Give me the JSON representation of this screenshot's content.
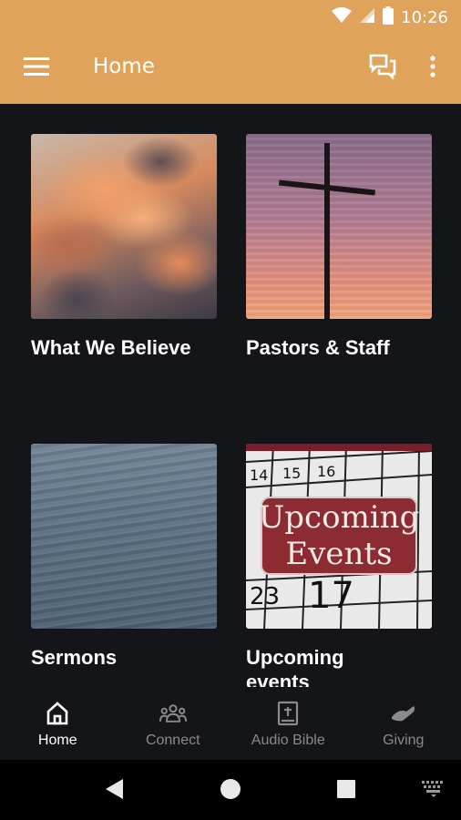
{
  "status_bar": {
    "time": "10:26",
    "icons": [
      "wifi-icon",
      "signal-icon",
      "battery-icon"
    ]
  },
  "app_bar": {
    "title": "Home",
    "icons": [
      "menu-icon",
      "chat-icon",
      "overflow-menu-icon"
    ],
    "background_color": "#E0A35C"
  },
  "tiles": [
    {
      "label": "What We Believe",
      "image": "clouds-photo"
    },
    {
      "label": "Pastors & Staff",
      "image": "cross-sky-photo"
    },
    {
      "label": "Sermons",
      "image": "sea-photo"
    },
    {
      "label": "Upcoming events",
      "image": "calendar-photo",
      "image_text_line1": "Upcoming",
      "image_text_line2": "Events"
    }
  ],
  "bottom_nav": {
    "items": [
      {
        "label": "Home",
        "icon": "home-icon",
        "active": true
      },
      {
        "label": "Connect",
        "icon": "group-icon",
        "active": false
      },
      {
        "label": "Audio Bible",
        "icon": "bible-icon",
        "active": false
      },
      {
        "label": "Giving",
        "icon": "giving-hand-icon",
        "active": false
      }
    ]
  },
  "system_nav": {
    "icons": [
      "back-icon",
      "home-circle-icon",
      "recents-icon",
      "keyboard-icon"
    ]
  },
  "colors": {
    "accent": "#E0A35C",
    "background": "#141518",
    "text_primary": "#FFFFFF",
    "text_inactive": "#8A8A8A"
  }
}
